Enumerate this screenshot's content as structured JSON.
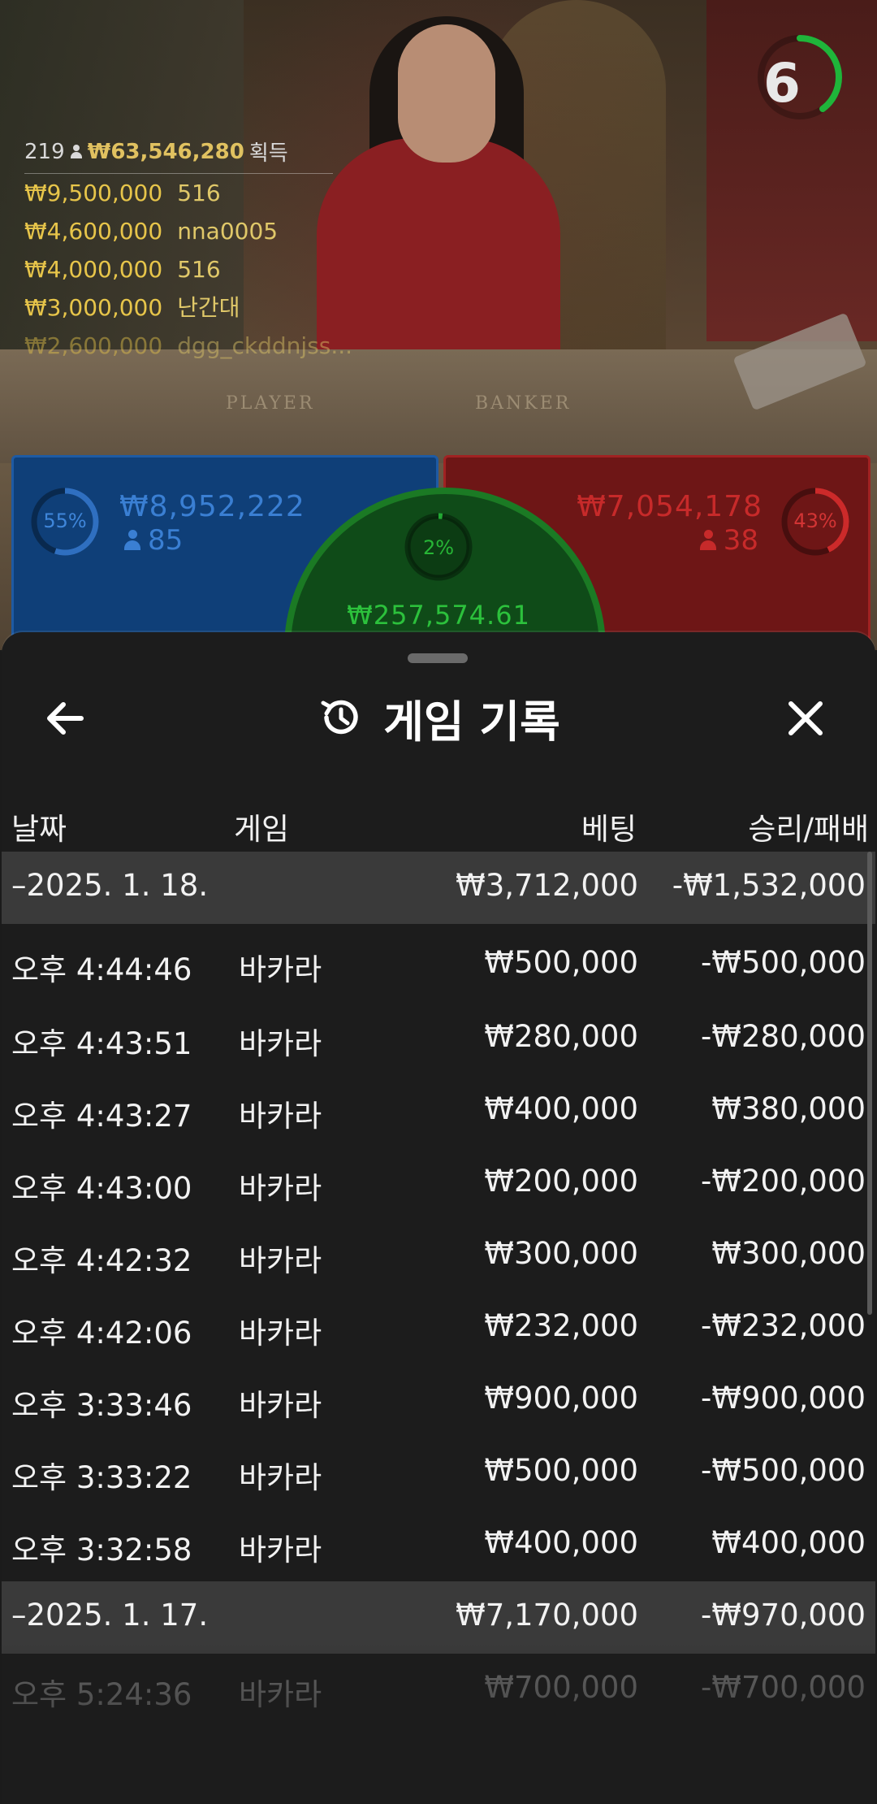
{
  "stream": {
    "countdown": "6",
    "countdown_fraction": 0.4,
    "table_labels": {
      "player": "PLAYER",
      "banker": "BANKER"
    }
  },
  "leaderboard": {
    "count": "219",
    "total": "₩63,546,280",
    "total_suffix": "획득",
    "winners": [
      {
        "amount": "₩9,500,000",
        "name": "516"
      },
      {
        "amount": "₩4,600,000",
        "name": "nna0005"
      },
      {
        "amount": "₩4,000,000",
        "name": "516"
      },
      {
        "amount": "₩3,000,000",
        "name": "난간대"
      },
      {
        "amount": "₩2,600,000",
        "name": "dgg_ckddnjss..."
      }
    ]
  },
  "bets": {
    "player": {
      "percent": "55%",
      "percent_value": 55,
      "amount": "₩8,952,222",
      "players": "85",
      "color": "#2f6fc0"
    },
    "tie": {
      "percent": "2%",
      "percent_value": 2,
      "amount": "₩257,574.61",
      "color": "#22a833"
    },
    "banker": {
      "percent": "43%",
      "percent_value": 43,
      "amount": "₩7,054,178",
      "players": "38",
      "color": "#cc2a2a"
    }
  },
  "history": {
    "title": "게임 기록",
    "columns": {
      "date": "날짜",
      "game": "게임",
      "bet": "베팅",
      "result": "승리/패배"
    },
    "rows": [
      {
        "type": "date",
        "date": "–2025. 1. 18.",
        "game": "",
        "bet": "₩3,712,000",
        "result": "-₩1,532,000"
      },
      {
        "type": "entry",
        "date": "오후 4:44:46",
        "game": "바카라",
        "bet": "₩500,000",
        "result": "-₩500,000"
      },
      {
        "type": "entry",
        "date": "오후 4:43:51",
        "game": "바카라",
        "bet": "₩280,000",
        "result": "-₩280,000"
      },
      {
        "type": "entry",
        "date": "오후 4:43:27",
        "game": "바카라",
        "bet": "₩400,000",
        "result": "₩380,000"
      },
      {
        "type": "entry",
        "date": "오후 4:43:00",
        "game": "바카라",
        "bet": "₩200,000",
        "result": "-₩200,000"
      },
      {
        "type": "entry",
        "date": "오후 4:42:32",
        "game": "바카라",
        "bet": "₩300,000",
        "result": "₩300,000"
      },
      {
        "type": "entry",
        "date": "오후 4:42:06",
        "game": "바카라",
        "bet": "₩232,000",
        "result": "-₩232,000"
      },
      {
        "type": "entry",
        "date": "오후 3:33:46",
        "game": "바카라",
        "bet": "₩900,000",
        "result": "-₩900,000"
      },
      {
        "type": "entry",
        "date": "오후 3:33:22",
        "game": "바카라",
        "bet": "₩500,000",
        "result": "-₩500,000"
      },
      {
        "type": "entry",
        "date": "오후 3:32:58",
        "game": "바카라",
        "bet": "₩400,000",
        "result": "₩400,000"
      },
      {
        "type": "date",
        "date": "–2025. 1. 17.",
        "game": "",
        "bet": "₩7,170,000",
        "result": "-₩970,000"
      },
      {
        "type": "entry",
        "date": "오후 5:24:36",
        "game": "바카라",
        "bet": "₩700,000",
        "result": "-₩700,000"
      }
    ]
  },
  "icons": {
    "back": "arrow-left-icon",
    "close": "close-icon",
    "history": "history-icon"
  }
}
